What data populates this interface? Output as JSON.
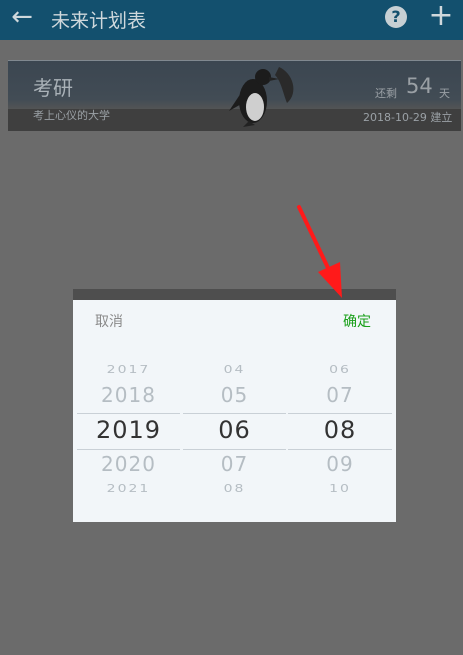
{
  "app_bar": {
    "title": "未来计划表",
    "back_icon": "arrow-left-icon",
    "help_icon": "question-circle-icon",
    "add_icon": "plus-icon",
    "help_glyph": "?",
    "add_glyph": "+"
  },
  "card": {
    "name": "考研",
    "description": "考上心仪的大学",
    "remaining_label": "还剩",
    "remaining_days": "54",
    "remaining_unit": "天",
    "created": "2018-10-29 建立"
  },
  "date_picker": {
    "cancel_label": "取消",
    "confirm_label": "确定",
    "years": [
      "2017",
      "2018",
      "2019",
      "2020",
      "2021"
    ],
    "months": [
      "04",
      "05",
      "06",
      "07",
      "08"
    ],
    "days": [
      "06",
      "07",
      "08",
      "09",
      "10"
    ],
    "selected": {
      "year": "2019",
      "month": "06",
      "day": "08"
    }
  },
  "colors": {
    "app_bar": "#13506e",
    "overlay": "#6b6b6b",
    "confirm": "#1aa01a",
    "annotation_arrow": "#ff1a1a"
  }
}
